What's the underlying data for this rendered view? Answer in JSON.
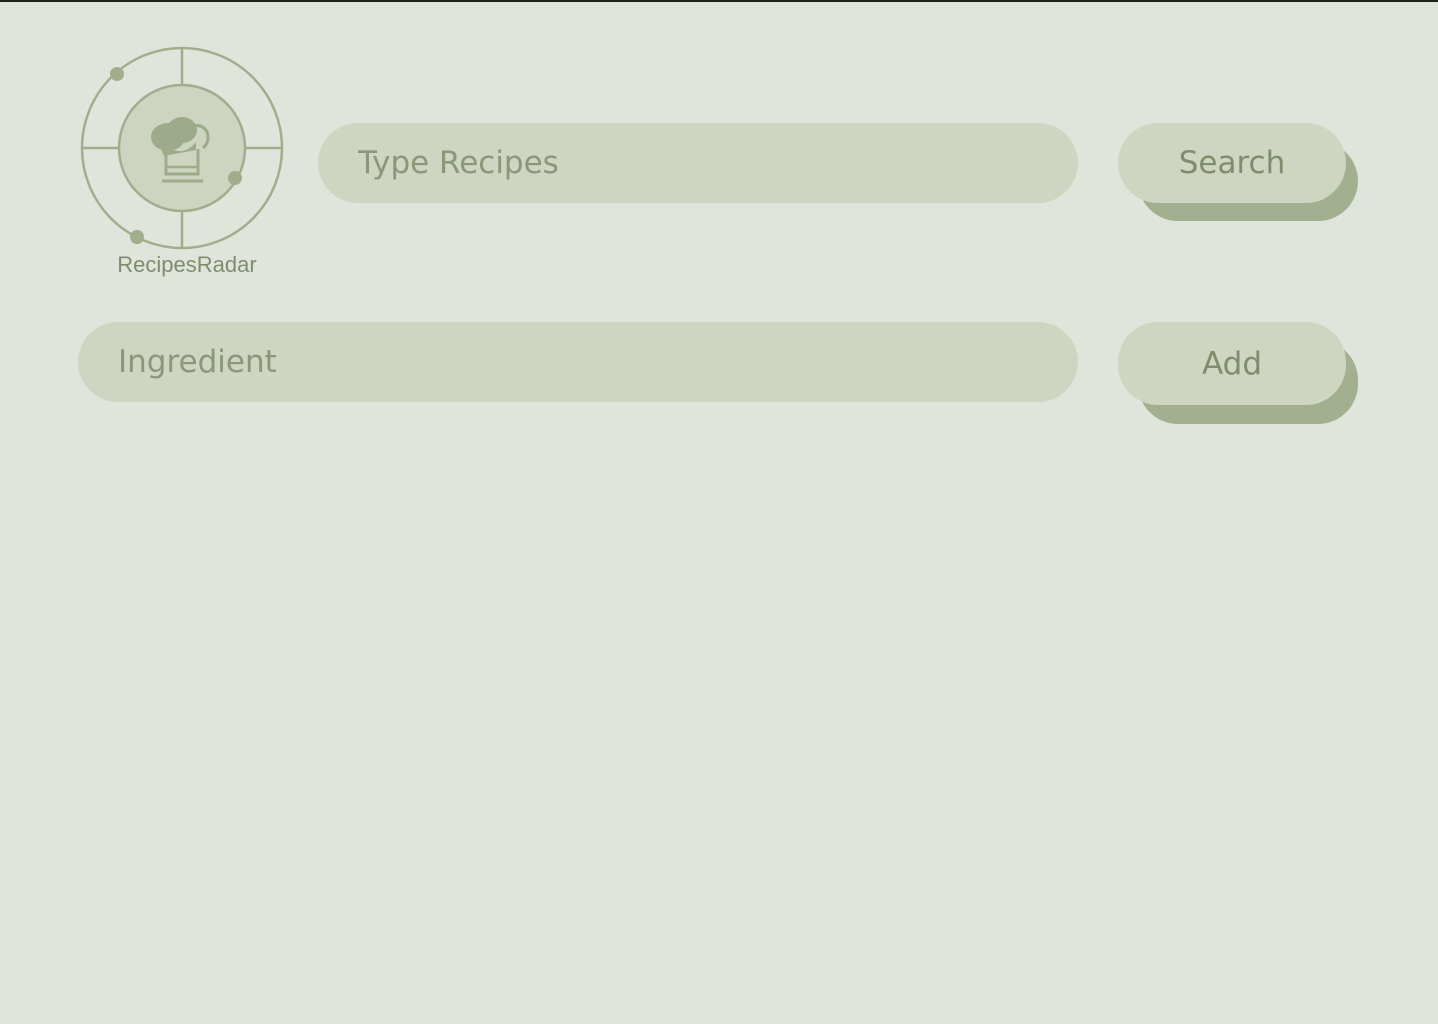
{
  "app": {
    "logo_text": "RecipesRadar",
    "logo_icon": "chef-hat-radar-icon"
  },
  "search": {
    "placeholder": "Type Recipes",
    "button_label": "Search"
  },
  "ingredient": {
    "placeholder": "Ingredient",
    "button_label": "Add"
  },
  "colors": {
    "background": "#e0e5dc",
    "pill": "#ced5c0",
    "shadow": "#a2b08f",
    "text": "#7f8d6d",
    "accent": "#9dab8a"
  }
}
